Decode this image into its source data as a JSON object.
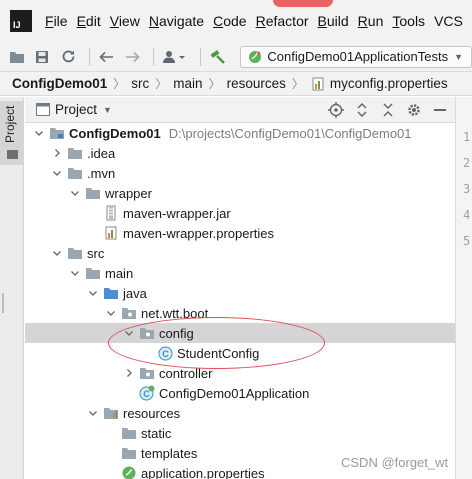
{
  "menu": {
    "items": [
      {
        "label": "File",
        "key": "F",
        "rest": "ile"
      },
      {
        "label": "Edit",
        "key": "E",
        "rest": "dit"
      },
      {
        "label": "View",
        "key": "V",
        "rest": "iew"
      },
      {
        "label": "Navigate",
        "key": "N",
        "rest": "avigate"
      },
      {
        "label": "Code",
        "key": "C",
        "rest": "ode"
      },
      {
        "label": "Refactor",
        "key": "R",
        "rest": "efactor"
      },
      {
        "label": "Build",
        "key": "B",
        "rest": "uild"
      },
      {
        "label": "Run",
        "key": "R",
        "rest": "un"
      },
      {
        "label": "Tools",
        "key": "T",
        "rest": "ools"
      },
      {
        "label": "VCS",
        "key": "",
        "rest": "VCS"
      }
    ]
  },
  "app_logo_text": "IJ",
  "toolbar": {
    "run_config": "ConfigDemo01ApplicationTests"
  },
  "breadcrumb": [
    "ConfigDemo01",
    "src",
    "main",
    "resources",
    "myconfig.properties"
  ],
  "left_strip": {
    "tab_label": "Project"
  },
  "panel": {
    "title": "Project"
  },
  "editor_lines": [
    "1",
    "2",
    "3",
    "4",
    "5"
  ],
  "tree": [
    {
      "label": "ConfigDemo01",
      "path": "D:\\projects\\ConfigDemo01\\ConfigDemo01",
      "depth": 0,
      "arrow": "open",
      "icon": "module-folder-icon"
    },
    {
      "label": ".idea",
      "depth": 1,
      "arrow": "closed",
      "icon": "folder-icon"
    },
    {
      "label": ".mvn",
      "depth": 1,
      "arrow": "open",
      "icon": "folder-icon"
    },
    {
      "label": "wrapper",
      "depth": 2,
      "arrow": "open",
      "icon": "folder-icon"
    },
    {
      "label": "maven-wrapper.jar",
      "depth": 3,
      "arrow": "none",
      "icon": "jar-file-icon"
    },
    {
      "label": "maven-wrapper.properties",
      "depth": 3,
      "arrow": "none",
      "icon": "properties-file-icon"
    },
    {
      "label": "src",
      "depth": 1,
      "arrow": "open",
      "icon": "folder-icon"
    },
    {
      "label": "main",
      "depth": 2,
      "arrow": "open",
      "icon": "folder-icon"
    },
    {
      "label": "java",
      "depth": 3,
      "arrow": "open",
      "icon": "source-folder-icon"
    },
    {
      "label": "net.wtt.boot",
      "depth": 4,
      "arrow": "open",
      "icon": "package-icon"
    },
    {
      "label": "config",
      "depth": 5,
      "arrow": "open",
      "icon": "package-icon",
      "selected": true
    },
    {
      "label": "StudentConfig",
      "depth": 6,
      "arrow": "none",
      "icon": "class-icon"
    },
    {
      "label": "controller",
      "depth": 5,
      "arrow": "closed",
      "icon": "package-icon"
    },
    {
      "label": "ConfigDemo01Application",
      "depth": 5,
      "arrow": "none",
      "icon": "spring-class-icon"
    },
    {
      "label": "resources",
      "depth": 3,
      "arrow": "open",
      "icon": "resources-folder-icon"
    },
    {
      "label": "static",
      "depth": 4,
      "arrow": "none",
      "icon": "folder-icon"
    },
    {
      "label": "templates",
      "depth": 4,
      "arrow": "none",
      "icon": "folder-icon"
    },
    {
      "label": "application.properties",
      "depth": 4,
      "arrow": "none",
      "icon": "spring-properties-icon"
    }
  ],
  "watermark": "CSDN @forget_wt",
  "colors": {
    "selection": "#d5d5d5",
    "annotation": "#e0505a",
    "class_icon": "#3592c4",
    "folder": "#9aa7b0"
  }
}
